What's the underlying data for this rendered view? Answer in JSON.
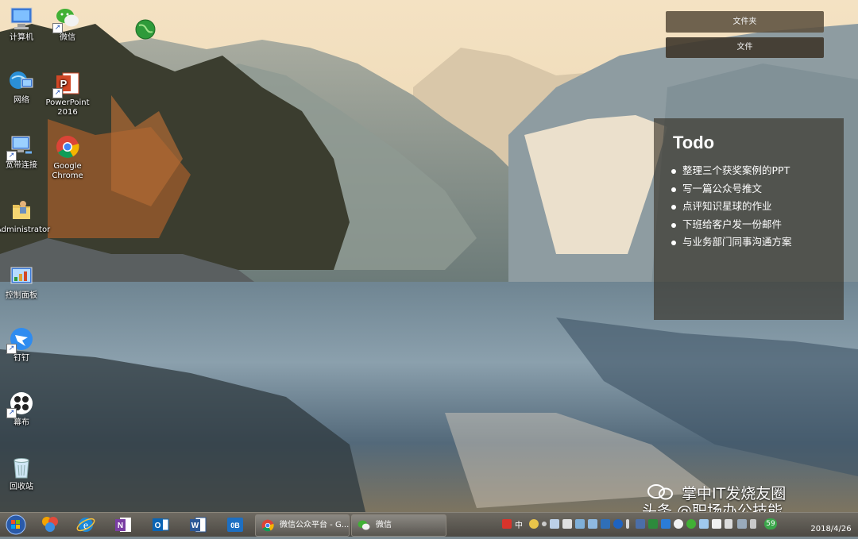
{
  "desktop": {
    "icons": [
      {
        "label": "计算机",
        "icon": "computer-icon"
      },
      {
        "label": "微信",
        "icon": "wechat-icon"
      },
      {
        "label": "",
        "icon": "globe-icon"
      },
      {
        "label": "网络",
        "icon": "network-icon"
      },
      {
        "label": "PowerPoint 2016",
        "icon": "powerpoint-icon"
      },
      {
        "label": "宽带连接",
        "icon": "broadband-icon"
      },
      {
        "label": "Google Chrome",
        "icon": "chrome-icon"
      },
      {
        "label": "Administrator",
        "icon": "user-folder-icon"
      },
      {
        "label": "控制面板",
        "icon": "control-panel-icon"
      },
      {
        "label": "钉钉",
        "icon": "dingtalk-icon"
      },
      {
        "label": "幕布",
        "icon": "mubu-icon"
      },
      {
        "label": "回收站",
        "icon": "recycle-bin-icon"
      }
    ]
  },
  "folders": {
    "btn1": "文件夹",
    "btn2": "文件"
  },
  "todo": {
    "title": "Todo",
    "items": [
      "整理三个获奖案例的PPT",
      "写一篇公众号推文",
      "点评知识星球的作业",
      "下班给客户发一份邮件",
      "与业务部门同事沟通方案"
    ]
  },
  "watermark": {
    "line1": "掌中IT发烧友圈",
    "line2": "头条 @职场办公技能"
  },
  "taskbar": {
    "pinned": [
      "start-orb",
      "ppt-tool-icon",
      "internet-explorer-icon",
      "onenote-icon",
      "outlook-icon",
      "word-icon",
      "onedrive-icon"
    ],
    "tasks": [
      {
        "label": "微信公众平台 - G...",
        "icon": "chrome-icon"
      },
      {
        "label": "微信",
        "icon": "wechat-icon"
      }
    ],
    "tray": {
      "ime": "中",
      "badge": "59"
    },
    "clock": {
      "time": "",
      "date": "2018/4/26"
    }
  },
  "colors": {
    "sky": "#eed8b6",
    "water": "#5d7687",
    "todo_bg": "#342d22",
    "taskbar": "#5b5750"
  }
}
